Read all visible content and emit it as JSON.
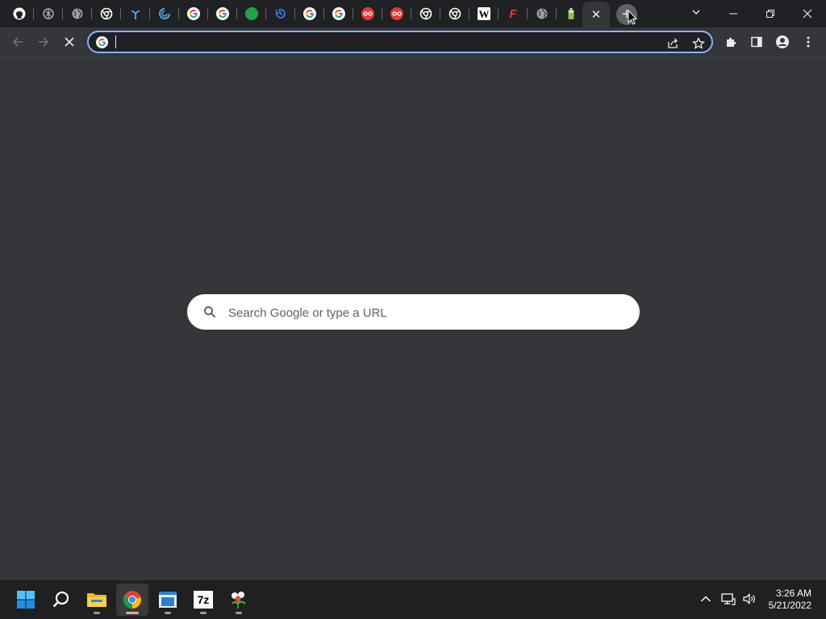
{
  "browser": {
    "pinned_tabs": [
      {
        "icon": "github-icon",
        "letter": "",
        "color": "#ffffff"
      },
      {
        "icon": "openai-icon",
        "letter": "",
        "color": "#bdc1c6"
      },
      {
        "icon": "globe-icon",
        "letter": "",
        "color": "#bdc1c6"
      },
      {
        "icon": "chrome-icon",
        "letter": "",
        "color": "#ffffff"
      },
      {
        "icon": "tool-icon",
        "letter": "",
        "color": "#4fa3e0"
      },
      {
        "icon": "sync-icon",
        "letter": "",
        "color": "#4fa3e0"
      },
      {
        "icon": "google-icon",
        "letter": "G",
        "color": "#ffffff"
      },
      {
        "icon": "google-icon",
        "letter": "G",
        "color": "#ffffff"
      },
      {
        "icon": "green-circle-icon",
        "letter": "",
        "color": "#1ea446"
      },
      {
        "icon": "history-icon",
        "letter": "",
        "color": "#4285f4"
      },
      {
        "icon": "google-icon",
        "letter": "G",
        "color": "#ffffff"
      },
      {
        "icon": "google-icon",
        "letter": "G",
        "color": "#ffffff"
      },
      {
        "icon": "incognito-red-icon",
        "letter": "",
        "color": "#e53935"
      },
      {
        "icon": "incognito-red-icon",
        "letter": "",
        "color": "#e53935"
      },
      {
        "icon": "chrome-icon",
        "letter": "",
        "color": "#ffffff"
      },
      {
        "icon": "chrome-icon",
        "letter": "",
        "color": "#ffffff"
      },
      {
        "icon": "wikipedia-icon",
        "letter": "W",
        "color": "#ffffff"
      },
      {
        "icon": "f-logo-icon",
        "letter": "F",
        "color": "#e53935"
      },
      {
        "icon": "globe-icon",
        "letter": "",
        "color": "#bdc1c6"
      },
      {
        "icon": "battery-icon",
        "letter": "",
        "color": "#8bc34a"
      }
    ],
    "active_tab_close": "✕",
    "new_tab": "+"
  },
  "omnibox": {
    "value": "",
    "placeholder": ""
  },
  "ntp": {
    "search_placeholder": "Search Google or type a URL"
  },
  "taskbar": {
    "apps": [
      "start-icon",
      "search-icon",
      "file-explorer-icon",
      "chrome-icon",
      "notepad-icon",
      "7zip-icon",
      "plant-app-icon"
    ],
    "sevenzip_label": "7z"
  },
  "clock": {
    "time": "3:26 AM",
    "date": "5/21/2022"
  },
  "colors": {
    "tabstrip": "#202124",
    "toolbar": "#35363a",
    "focus_ring": "#8ab4f8",
    "taskbar": "#202020"
  }
}
